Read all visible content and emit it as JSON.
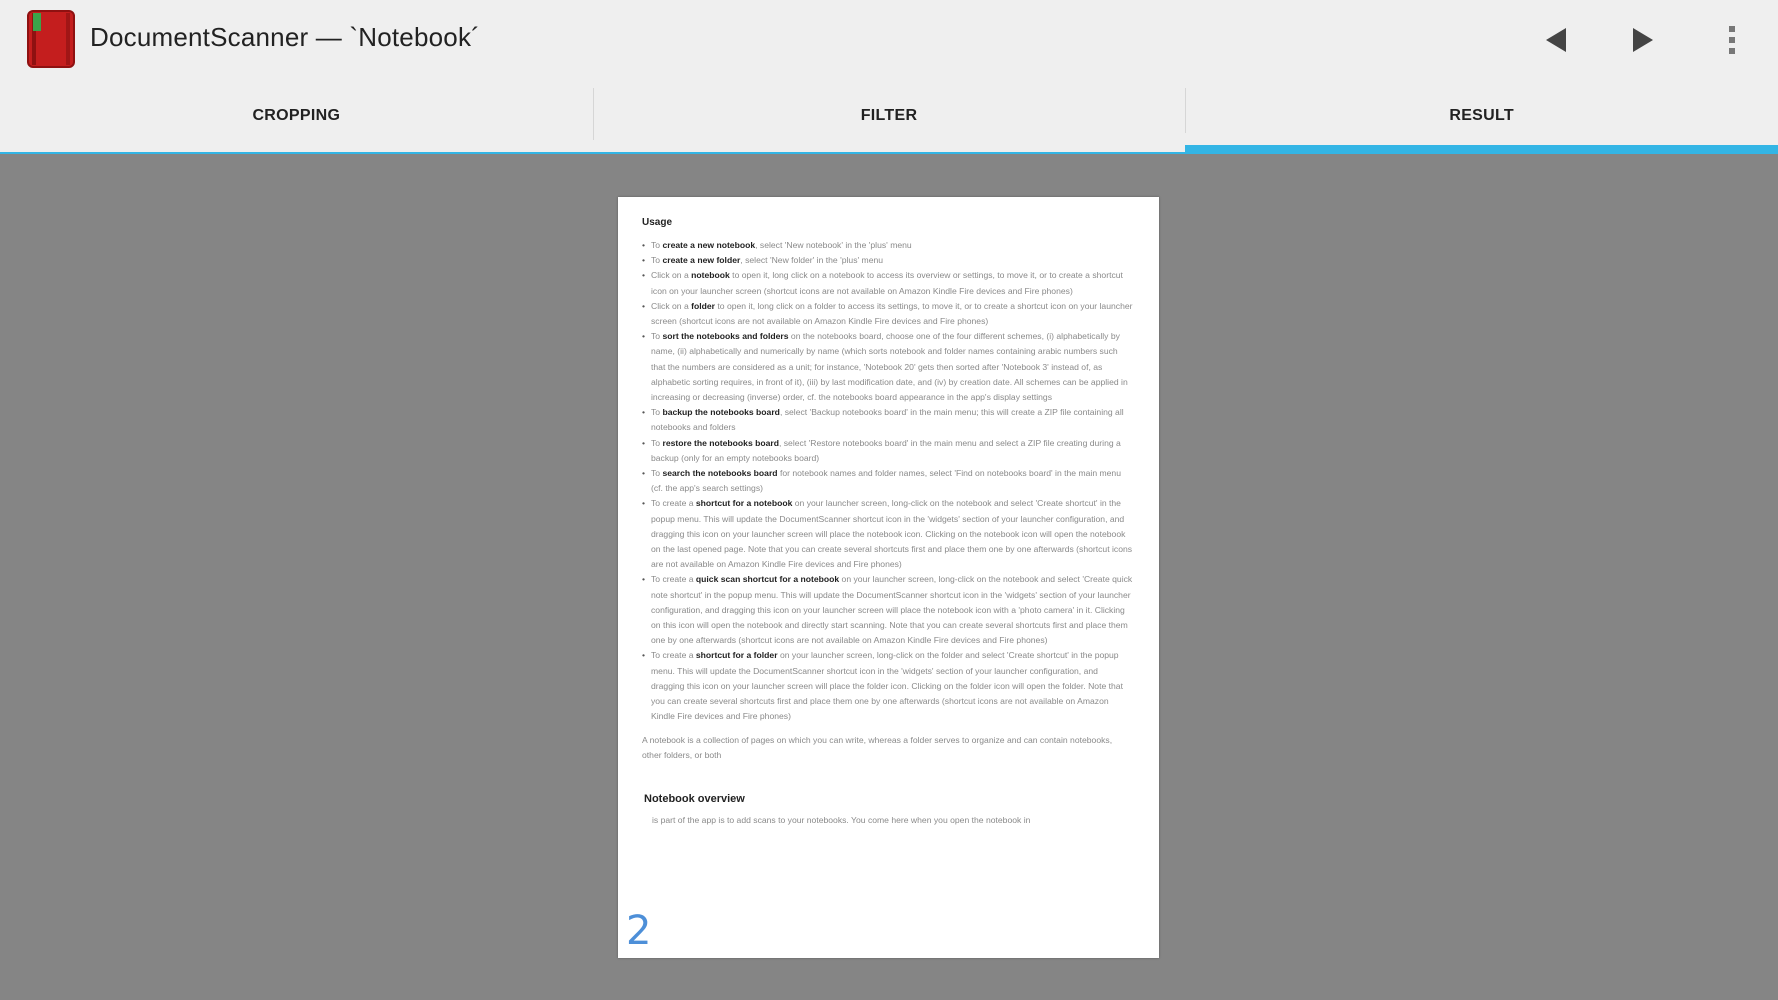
{
  "actionbar": {
    "title": "DocumentScanner — `Notebook´",
    "app_icon": "notebook-app-icon",
    "prev_icon": "triangle-left-icon",
    "next_icon": "triangle-right-icon",
    "overflow_icon": "vertical-dots-icon"
  },
  "tabs": [
    {
      "label": "CROPPING",
      "active": false
    },
    {
      "label": "FILTER",
      "active": false
    },
    {
      "label": "RESULT",
      "active": true
    }
  ],
  "colors": {
    "accent": "#33b5e5",
    "background": "#858585",
    "bar": "#efefef",
    "page_number": "#4d8fd8"
  },
  "document": {
    "heading": "Usage",
    "items": [
      {
        "pre": "To ",
        "bold": "create a new notebook",
        "post": ", select 'New notebook' in the 'plus' menu"
      },
      {
        "pre": "To ",
        "bold": "create a new folder",
        "post": ", select 'New folder' in the 'plus' menu"
      },
      {
        "pre": "Click on a ",
        "bold": "notebook",
        "post": " to open it, long click on a notebook to access its overview or settings, to move it, or to create a shortcut icon on your launcher screen (shortcut icons are not available on Amazon Kindle Fire devices and Fire phones)"
      },
      {
        "pre": "Click on a ",
        "bold": "folder",
        "post": " to open it, long click on a folder to access its settings, to move it, or to create a shortcut icon on your launcher screen (shortcut icons are not available on Amazon Kindle Fire devices and Fire phones)"
      },
      {
        "pre": "To ",
        "bold": "sort the notebooks and folders",
        "post": " on the notebooks board, choose one of the four different schemes, (i) alphabetically by name, (ii) alphabetically and numerically by name (which sorts notebook and folder names containing arabic numbers such that the numbers are considered as a unit; for instance, 'Notebook 20' gets then sorted after 'Notebook 3' instead of, as alphabetic sorting requires, in front of it), (iii) by last modification date, and (iv) by creation date. All schemes can be applied in increasing or decreasing (inverse) order, cf. the notebooks board appearance in the app's display settings"
      },
      {
        "pre": "To ",
        "bold": "backup the notebooks board",
        "post": ", select 'Backup notebooks board' in the main menu; this will create a ZIP file containing all notebooks and folders"
      },
      {
        "pre": "To ",
        "bold": "restore the notebooks board",
        "post": ", select 'Restore notebooks board' in the main menu and select a ZIP file creating during a backup (only for an empty notebooks board)"
      },
      {
        "pre": "To ",
        "bold": "search the notebooks board",
        "post": " for notebook names and folder names, select 'Find on notebooks board' in the main menu (cf. the app's search settings)"
      },
      {
        "pre": "To create a ",
        "bold": "shortcut for a notebook",
        "post": " on your launcher screen, long-click on the notebook and select 'Create shortcut' in the popup menu. This will update the DocumentScanner shortcut icon in the 'widgets' section of your launcher configuration, and dragging this icon on your launcher screen will place the notebook icon. Clicking on the notebook icon will open the notebook on the last opened page. Note that you can create several shortcuts first and place them one by one afterwards (shortcut icons are not available on Amazon Kindle Fire devices and Fire phones)"
      },
      {
        "pre": "To create a ",
        "bold": "quick scan shortcut for a notebook",
        "post": " on your launcher screen, long-click on the notebook and select 'Create quick note shortcut' in the popup menu. This will update the DocumentScanner shortcut icon in the 'widgets' section of your launcher configuration, and dragging this icon on your launcher screen will place the notebook icon with a 'photo camera' in it. Clicking on this icon will open the notebook and directly start scanning. Note that you can create several shortcuts first and place them one by one afterwards (shortcut icons are not available on Amazon Kindle Fire devices and Fire phones)"
      },
      {
        "pre": "To create a ",
        "bold": "shortcut for a folder",
        "post": " on your launcher screen, long-click on the folder and select 'Create shortcut' in the popup menu. This will update the DocumentScanner shortcut icon in the 'widgets' section of your launcher configuration, and dragging this icon on your launcher screen will place the folder icon. Clicking on the folder icon will open the folder. Note that you can create several shortcuts first and place them one by one afterwards (shortcut icons are not available on Amazon Kindle Fire devices and Fire phones)"
      }
    ],
    "paragraph": "A notebook is a collection of pages on which you can write, whereas a folder serves to organize and can contain notebooks, other folders, or both",
    "subheading": "Notebook overview",
    "bottom_text": "is part of the app is to add scans to your notebooks. You come here when you open the notebook in",
    "page_number": "2"
  }
}
